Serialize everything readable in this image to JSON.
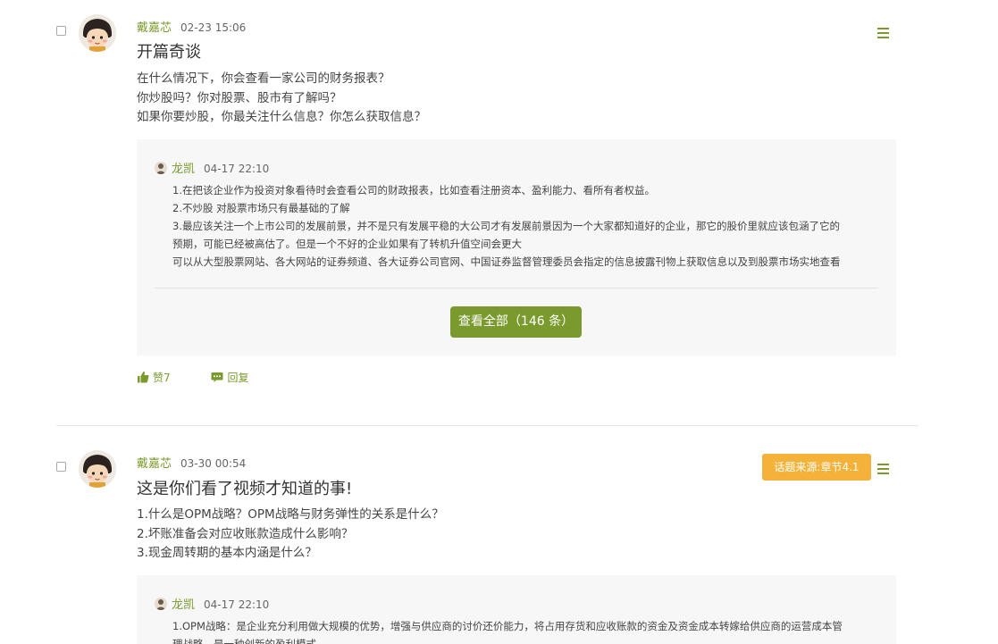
{
  "posts": [
    {
      "author": "戴嘉芯",
      "time": "02-23 15:06",
      "title": "开篇奇谈",
      "body": [
        "在什么情况下，你会查看一家公司的财务报表？",
        "你炒股吗？你对股票、股市有了解吗？",
        "如果你要炒股，你最关注什么信息？你怎么获取信息？"
      ],
      "reply": {
        "author": "龙凯",
        "time": "04-17 22:10",
        "lines": [
          "1.在把该企业作为投资对象看待时会查看公司的财政报表，比如查看注册资本、盈利能力、看所有者权益。",
          "2.不炒股 对股票市场只有最基础的了解",
          "3.最应该关注一个上市公司的发展前景，并不是只有发展平稳的大公司才有发展前景因为一个大家都知道好的企业，那它的股价里就应该包涵了它的",
          "预期，可能已经被高估了。但是一个不好的企业如果有了转机升值空间会更大",
          "可以从大型股票网站、各大网站的证券频道、各大证券公司官网、中国证券监督管理委员会指定的信息披露刊物上获取信息以及到股票市场实地查看"
        ]
      },
      "view_all_label": "查看全部（146 条）",
      "like_label": "赞7",
      "reply_label": "回复"
    },
    {
      "author": "戴嘉芯",
      "time": "03-30 00:54",
      "badge": "话题来源:章节4.1",
      "title": "这是你们看了视频才知道的事!",
      "body": [
        "1.什么是OPM战略？OPM战略与财务弹性的关系是什么？",
        "2.坏账准备会对应收账款造成什么影响？",
        "3.现金周转期的基本内涵是什么？"
      ],
      "reply": {
        "author": "龙凯",
        "time": "04-17 22:10",
        "lines": [
          "1.OPM战略：是企业充分利用做大规模的优势，增强与供应商的讨价还价能力，将占用存货和应收账款的资金及资金成本转嫁给供应商的运营成本管",
          "理战略，是一种创新的盈利模式"
        ]
      }
    }
  ],
  "colors": {
    "accent": "#7a9a2e",
    "badge": "#f4b23a",
    "reply_bg": "#f7f7f7"
  }
}
